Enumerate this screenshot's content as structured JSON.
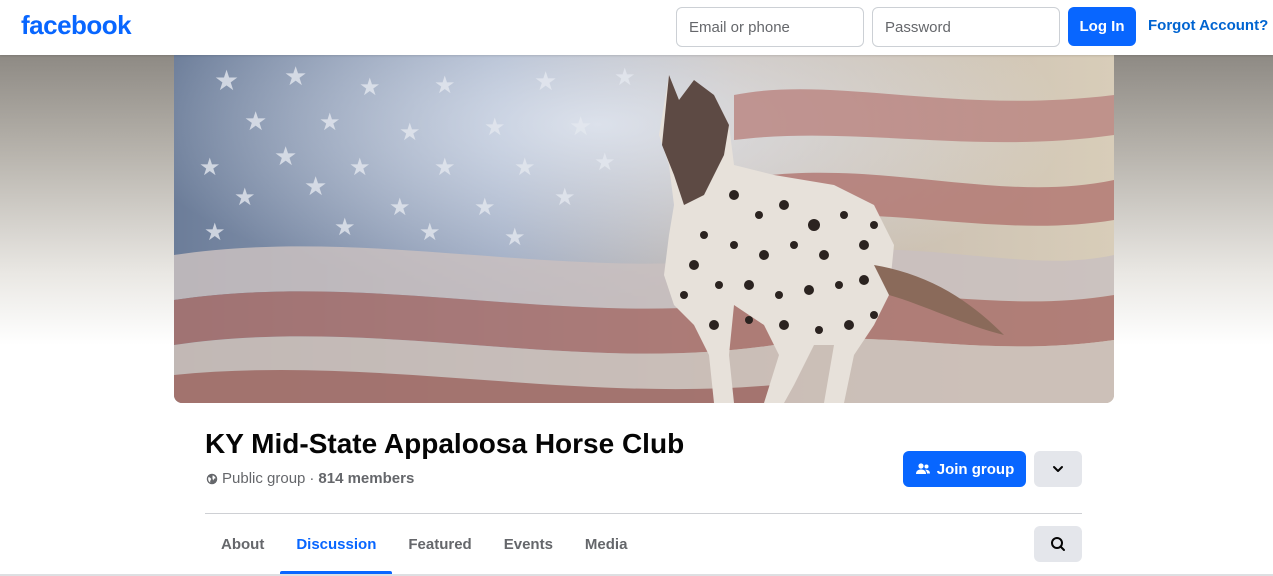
{
  "header": {
    "logo_text": "facebook",
    "email_placeholder": "Email or phone",
    "password_placeholder": "Password",
    "login_label": "Log In",
    "forgot_label": "Forgot Account?"
  },
  "group": {
    "title": "KY Mid-State Appaloosa Horse Club",
    "privacy": "Public group",
    "separator": "·",
    "members": "814 members",
    "join_label": "Join group",
    "join_icon": "people-icon",
    "more_icon": "chevron-down-icon"
  },
  "tabs": [
    {
      "label": "About",
      "active": false
    },
    {
      "label": "Discussion",
      "active": true
    },
    {
      "label": "Featured",
      "active": false
    },
    {
      "label": "Events",
      "active": false
    },
    {
      "label": "Media",
      "active": false
    }
  ],
  "search_icon": "search-icon",
  "colors": {
    "brand": "#0866ff",
    "link": "#0064d1",
    "secondary_text": "#65676b",
    "button_gray": "#e4e6eb"
  }
}
